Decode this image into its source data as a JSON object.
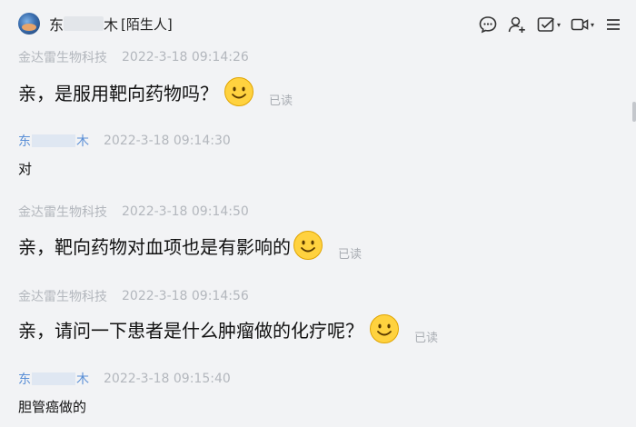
{
  "header": {
    "contact_name_start": "东",
    "contact_name_end": "木",
    "contact_tag": "[陌生人]",
    "toolbar": [
      {
        "name": "chat-bubble-icon"
      },
      {
        "name": "add-contact-icon"
      },
      {
        "name": "checkbox-task-icon",
        "caret": "▾"
      },
      {
        "name": "video-call-icon",
        "caret": "▾"
      },
      {
        "name": "more-menu-icon"
      }
    ]
  },
  "messages": [
    {
      "sender": "金达雷生物科技",
      "time": "2022-3-18 09:14:26",
      "text": "亲，是服用靶向药物吗？",
      "emoji": "smile",
      "status": "已读"
    },
    {
      "sender_start": "东",
      "sender_end": "木",
      "time": "2022-3-18 09:14:30",
      "text": "对"
    },
    {
      "sender": "金达雷生物科技",
      "time": "2022-3-18 09:14:50",
      "text": "亲，靶向药物对血项也是有影响的",
      "emoji": "smile",
      "status": "已读"
    },
    {
      "sender": "金达雷生物科技",
      "time": "2022-3-18 09:14:56",
      "text": "亲，请问一下患者是什么肿瘤做的化疗呢？",
      "emoji": "smile",
      "status": "已读"
    },
    {
      "sender_start": "东",
      "sender_end": "木",
      "time": "2022-3-18 09:15:40",
      "text": "胆管癌做的"
    }
  ],
  "colors": {
    "background": "#f2f3f5",
    "sender_company": "#b3b7bd",
    "sender_user": "#5a8fd6",
    "read_status": "#a9adb3"
  }
}
